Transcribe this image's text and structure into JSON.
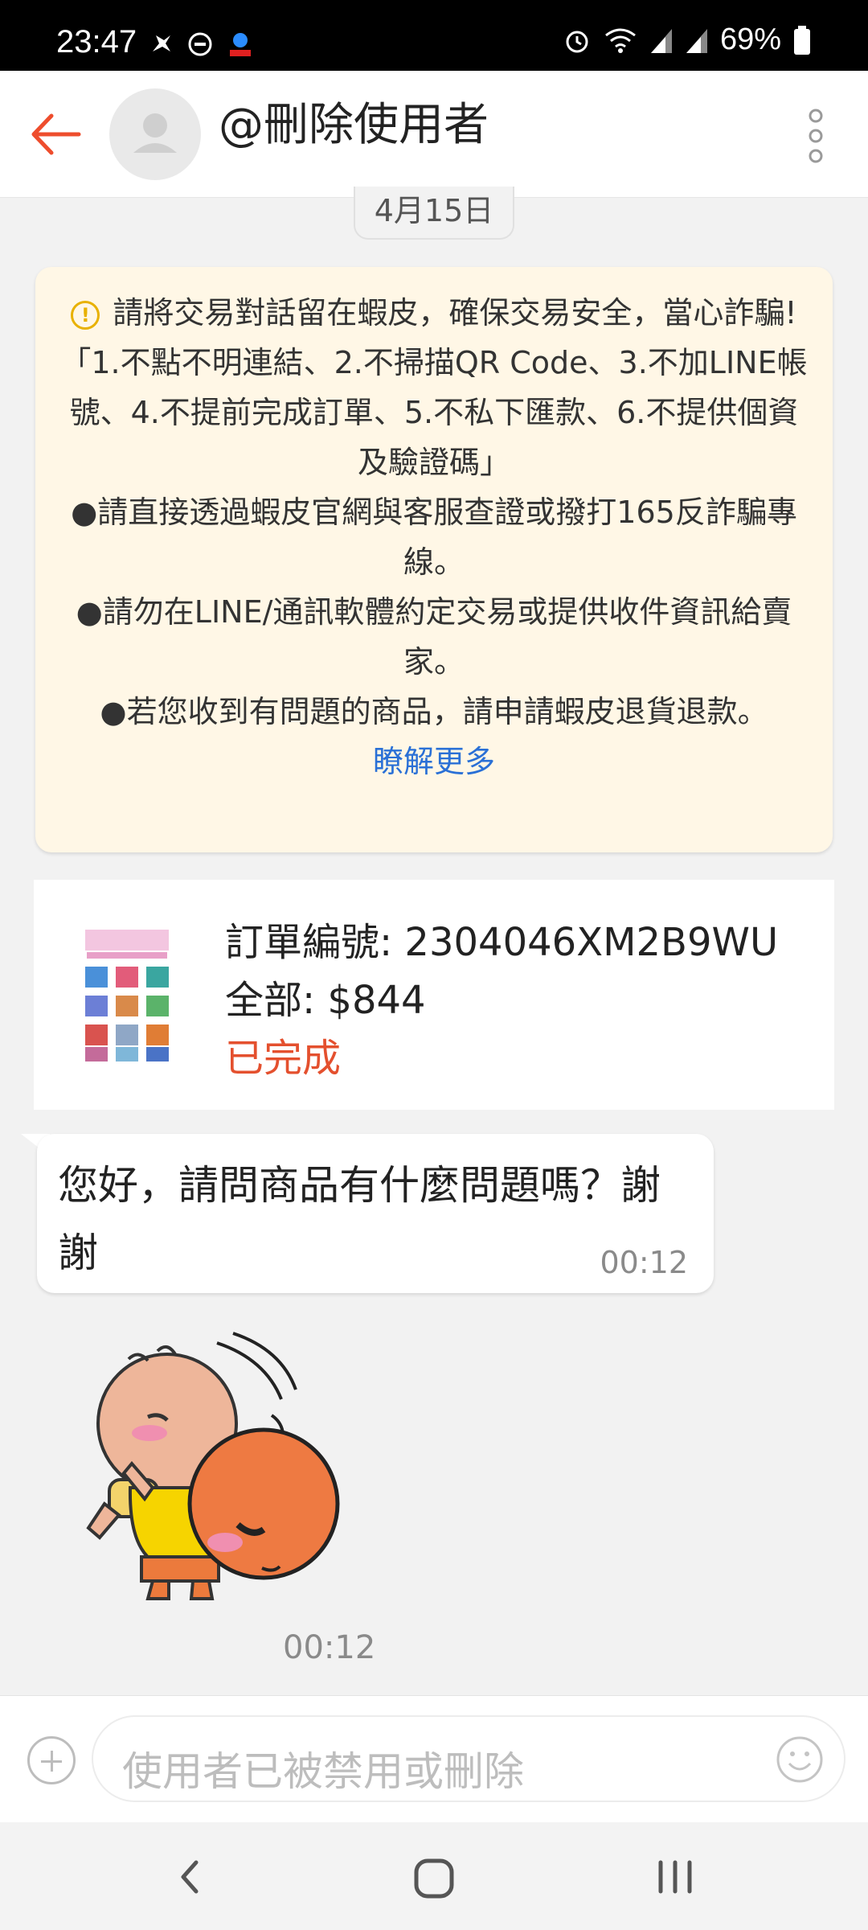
{
  "status_bar": {
    "time": "23:47",
    "battery": "69%",
    "icons": [
      "fan-icon",
      "dnd-icon",
      "app-badge-icon",
      "alarm-icon",
      "wifi-icon",
      "signal-icon",
      "signal-icon",
      "battery-icon"
    ]
  },
  "header": {
    "title": "@刪除使用者",
    "back_icon": "arrow-left-icon",
    "more_icon": "more-vertical-icon"
  },
  "date_chip": "4月15日",
  "notice": {
    "lines": [
      "請將交易對話留在蝦皮，確保交易安全，當心詐騙!",
      "「1.不點不明連結、2.不掃描QR Code、3.不加LINE帳號、4.不提前完成訂單、5.不私下匯款、6.不提供個資及驗證碼」",
      "●請直接透過蝦皮官網與客服查證或撥打165反詐騙專線。",
      "●請勿在LINE/通訊軟體約定交易或提供收件資訊給賣家。",
      "●若您收到有問題的商品，請申請蝦皮退貨退款。"
    ],
    "learn_more": "瞭解更多",
    "accent": "#e8b100"
  },
  "order": {
    "number_line": "訂單編號: 2304046XM2B9WU",
    "total_line": "全部: $844",
    "status": "已完成",
    "status_color": "#e4502e"
  },
  "messages": [
    {
      "text": "您好，請問商品有什麼問題嗎？謝謝",
      "time": "00:12"
    }
  ],
  "sticker": {
    "time": "00:12"
  },
  "input": {
    "placeholder": "使用者已被禁用或刪除"
  },
  "colors": {
    "brand": "#ee4d2d",
    "link": "#2a70d6"
  }
}
